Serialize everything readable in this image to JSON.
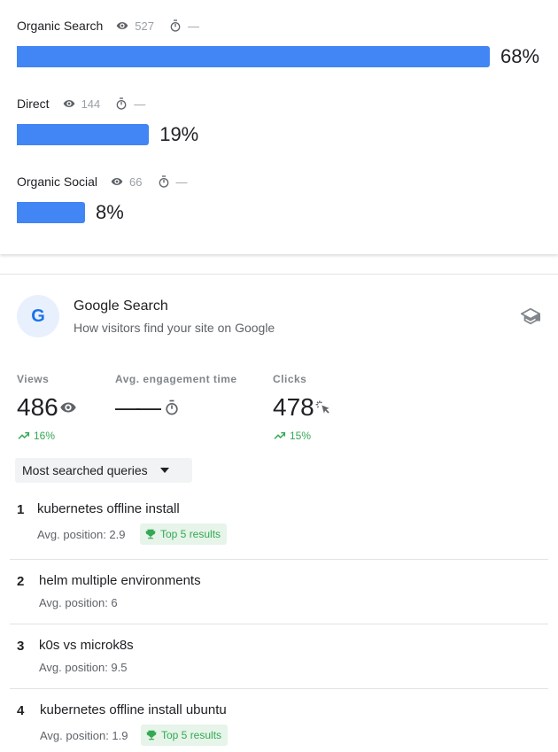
{
  "channels": [
    {
      "label": "Organic Search",
      "views": "527",
      "time": "—",
      "percent": "68%",
      "value": 68
    },
    {
      "label": "Direct",
      "views": "144",
      "time": "—",
      "percent": "19%",
      "value": 19
    },
    {
      "label": "Organic Social",
      "views": "66",
      "time": "—",
      "percent": "8%",
      "value": 8
    }
  ],
  "colors": {
    "bar": "#4285f4",
    "positive": "#34a853",
    "badge_bg": "#e6f4ea"
  },
  "google": {
    "icon_letter": "G",
    "title": "Google Search",
    "subtitle": "How visitors find your site on Google",
    "metrics": [
      {
        "label": "Views",
        "value": "486",
        "trend": "16%"
      },
      {
        "label": "Avg. engagement time",
        "value": "——"
      },
      {
        "label": "Clicks",
        "value": "478",
        "trend": "15%"
      }
    ],
    "dropdown": "Most searched queries",
    "queries": [
      {
        "rank": "1",
        "text": "kubernetes offline install",
        "avg": "Avg. position: 2.9",
        "badge": "Top 5 results"
      },
      {
        "rank": "2",
        "text": "helm multiple environments",
        "avg": "Avg. position: 6"
      },
      {
        "rank": "3",
        "text": "k0s vs microk8s",
        "avg": "Avg. position: 9.5"
      },
      {
        "rank": "4",
        "text": "kubernetes offline install ubuntu",
        "avg": "Avg. position: 1.9",
        "badge": "Top 5 results"
      }
    ]
  }
}
